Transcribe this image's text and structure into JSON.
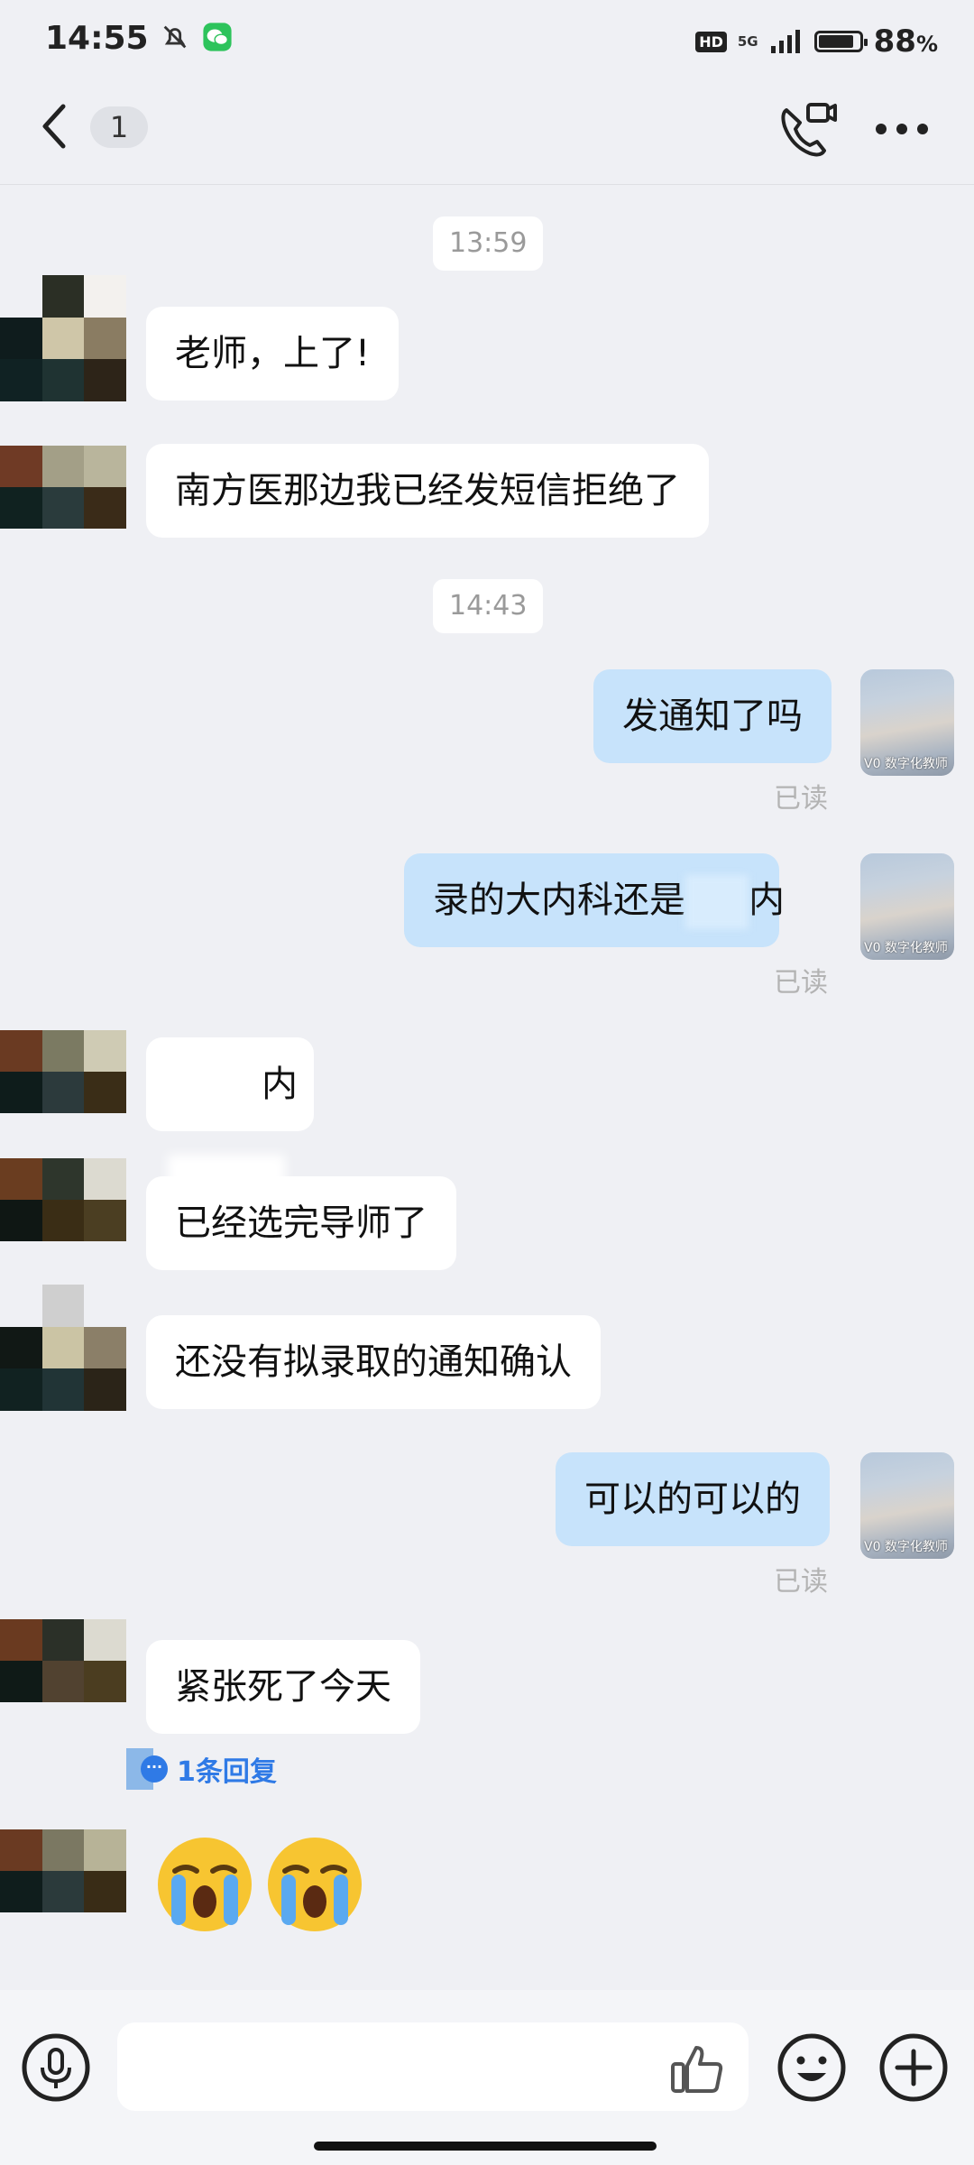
{
  "status_bar": {
    "time": "14:55",
    "network": "5G",
    "hd": "HD",
    "battery": "88",
    "battery_unit": "%",
    "battery_level": 0.88
  },
  "header": {
    "unread_count": "1"
  },
  "messages": {
    "ts1": "13:59",
    "m1": "老师，上了!",
    "m2": "南方医那边我已经发短信拒绝了",
    "ts2": "14:43",
    "m3": "发通知了吗",
    "m3_status": "已读",
    "m4_part1": "录的大内科还是",
    "m4_part2": "内",
    "m4_status": "已读",
    "m5_fragment": "内",
    "m6": "已经选完导师了",
    "m7": "还没有拟录取的通知确认",
    "m8": "可以的可以的",
    "m8_status": "已读",
    "m9": "紧张死了今天",
    "m9_reply": "1条回复"
  },
  "my_avatar_watermark": "V0 数字化教师",
  "colors": {
    "background": "#eff0f4",
    "outgoing_bubble": "#c7e3fb",
    "incoming_bubble": "#ffffff",
    "link": "#2f7ae6"
  },
  "icons": {
    "back": "chevron-left-icon",
    "call": "video-call-icon",
    "more": "more-horizontal-icon",
    "voice": "microphone-icon",
    "like": "thumbs-up-icon",
    "emoji": "smiley-icon",
    "plus": "plus-icon"
  }
}
